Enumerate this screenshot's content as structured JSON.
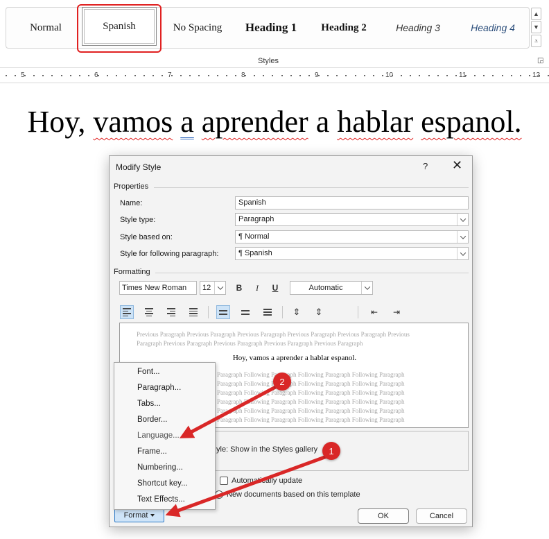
{
  "ribbon": {
    "styles": [
      "Normal",
      "Spanish",
      "No Spacing",
      "Heading 1",
      "Heading 2",
      "Heading 3",
      "Heading 4"
    ],
    "selected_style": "Spanish",
    "group_label": "Styles"
  },
  "ruler": {
    "numbers": [
      "5",
      "6",
      "7",
      "8",
      "9",
      "10",
      "11",
      "12"
    ]
  },
  "document": {
    "words": [
      "Hoy,",
      "vamos",
      "a",
      "aprender",
      "a",
      "hablar",
      "espanol."
    ]
  },
  "dialog": {
    "title": "Modify Style",
    "help": "?",
    "close": "✕",
    "properties_label": "Properties",
    "name_label": "Name:",
    "name_value": "Spanish",
    "style_type_label": "Style type:",
    "style_type_value": "Paragraph",
    "based_on_label": "Style based on:",
    "based_on_value": "¶  Normal",
    "following_label": "Style for following paragraph:",
    "following_value": "¶  Spanish",
    "formatting_label": "Formatting",
    "font": "Times New Roman",
    "size": "12",
    "bold": "B",
    "italic": "I",
    "underline": "U",
    "color": "Automatic",
    "preview_previous": "Previous Paragraph Previous Paragraph Previous Paragraph Previous Paragraph Previous Paragraph Previous Paragraph Previous Paragraph Previous Paragraph Previous Paragraph Previous Paragraph",
    "preview_sample": "Hoy, vamos a aprender a hablar espanol.",
    "preview_following": [
      "Paragraph Following Paragraph Following Paragraph Following Paragraph",
      "Paragraph Following Paragraph Following Paragraph Following Paragraph",
      "Paragraph Following Paragraph Following Paragraph Following Paragraph",
      "Paragraph Following Paragraph Following Paragraph Following Paragraph",
      "Paragraph Following Paragraph Following Paragraph Following Paragraph",
      "Paragraph Following Paragraph Following Paragraph Following Paragraph"
    ],
    "description": "yle: Show in the Styles gallery",
    "auto_update_label": "Automatically update",
    "new_docs_label": "New documents based on this template",
    "format_button": "Format",
    "ok_button": "OK",
    "cancel_button": "Cancel"
  },
  "format_menu": [
    "Font...",
    "Paragraph...",
    "Tabs...",
    "Border...",
    "Language...",
    "Frame...",
    "Numbering...",
    "Shortcut key...",
    "Text Effects..."
  ],
  "annotations": {
    "badge_1": "1",
    "badge_2": "2",
    "accent_color": "#d92727"
  }
}
